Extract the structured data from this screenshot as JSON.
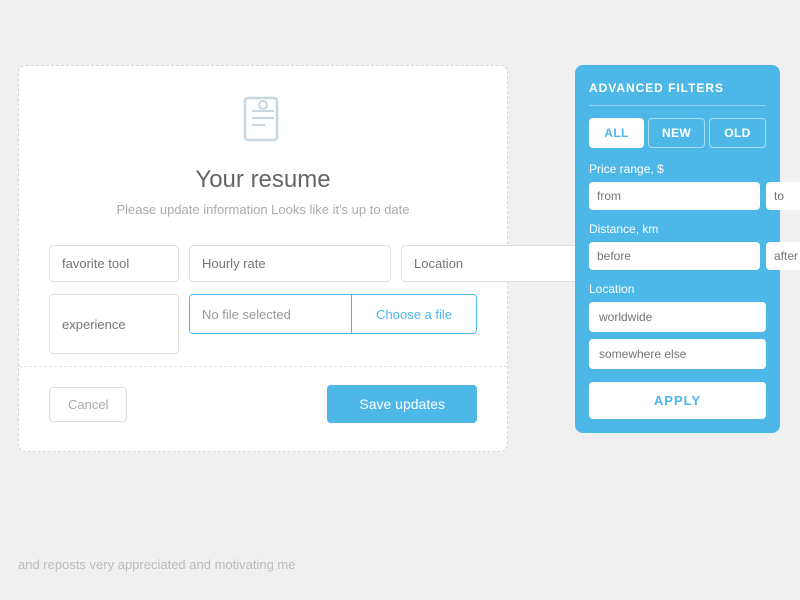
{
  "main_card": {
    "resume_icon": "📄",
    "title": "Your resume",
    "subtitle": "Please update information Looks like it's up to date",
    "fields": {
      "favorite_tool_placeholder": "favorite tool",
      "hourly_rate_placeholder": "Hourly rate",
      "location_placeholder": "Location",
      "experience_placeholder": "experience",
      "no_file_label": "No file selected",
      "choose_file_label": "Choose a file"
    },
    "actions": {
      "cancel_label": "Cancel",
      "save_label": "Save updates"
    }
  },
  "filters_panel": {
    "title": "ADVANCED FILTERS",
    "tabs": [
      {
        "label": "ALL",
        "active": true
      },
      {
        "label": "NEW",
        "active": false
      },
      {
        "label": "OLD",
        "active": false
      }
    ],
    "price_range": {
      "label": "Price range, $",
      "from_placeholder": "from",
      "to_placeholder": "to"
    },
    "distance": {
      "label": "Distance, km",
      "before_placeholder": "before",
      "after_placeholder": "after"
    },
    "location": {
      "label": "Location",
      "option1_placeholder": "worldwide",
      "option2_placeholder": "somewhere else"
    },
    "apply_label": "APPLY"
  },
  "bottom_text": "and reposts very appreciated and motivating me"
}
